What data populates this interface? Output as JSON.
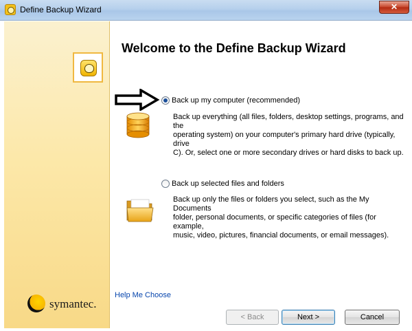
{
  "window": {
    "title": "Define Backup Wizard",
    "close_label": "✕"
  },
  "sidebar": {
    "brand": "symantec."
  },
  "main": {
    "heading": "Welcome to the Define Backup Wizard",
    "options": [
      {
        "label": "Back up my computer (recommended)",
        "selected": true,
        "description": [
          "Back up everything (all files, folders, desktop settings, programs, and the",
          "operating system) on your computer's primary hard drive (typically, drive",
          "C). Or, select one or more secondary drives or hard disks to back up."
        ]
      },
      {
        "label": "Back up selected files and folders",
        "selected": false,
        "description": [
          "Back up only the files or folders you select, such as the My Documents",
          "folder, personal documents, or specific categories of files (for example,",
          "music, video, pictures, financial documents, or email messages)."
        ]
      }
    ],
    "help_link": "Help Me Choose"
  },
  "buttons": {
    "back": "< Back",
    "next": "Next >",
    "cancel": "Cancel"
  },
  "colors": {
    "sidebar_gradient_top": "#fbf1cf",
    "sidebar_gradient_bottom": "#f8d987",
    "radio_selected": "#1b4f9a",
    "link": "#0645ad"
  },
  "icons": [
    "app-icon",
    "norton-logo-icon",
    "arrow-pointer-icon",
    "database-icon",
    "folder-icon",
    "symantec-logo-icon"
  ]
}
